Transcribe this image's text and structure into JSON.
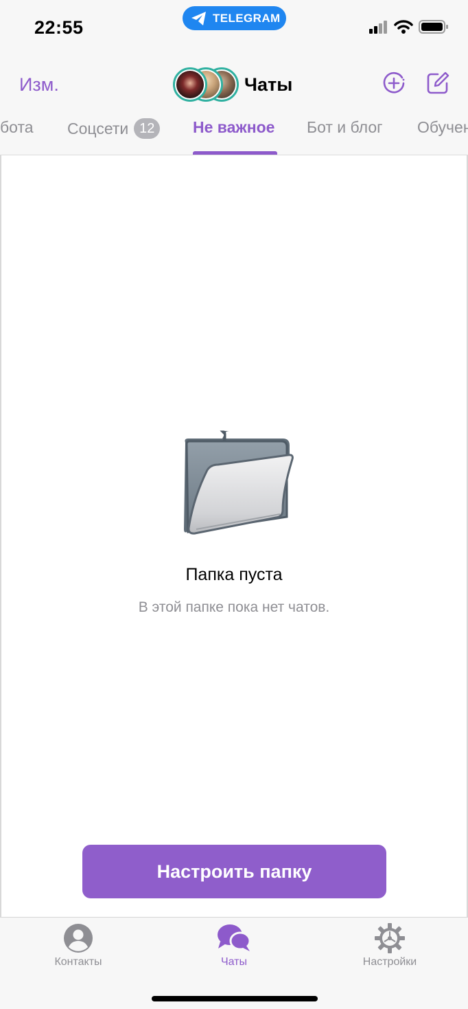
{
  "status_bar": {
    "time": "22:55",
    "pill_label": "TELEGRAM"
  },
  "nav": {
    "edit_label": "Изм.",
    "title": "Чаты",
    "icons": [
      "add-story-icon",
      "compose-icon"
    ]
  },
  "folder_tabs": [
    {
      "label": "бота",
      "active": false
    },
    {
      "label": "Соцсети",
      "badge": "12",
      "active": false
    },
    {
      "label": "Не важное",
      "active": true
    },
    {
      "label": "Бот и блог",
      "active": false
    },
    {
      "label": "Обучен",
      "active": false
    }
  ],
  "empty_state": {
    "title": "Папка пуста",
    "subtitle": "В этой папке пока нет чатов.",
    "icon": "folder-icon"
  },
  "primary_button": {
    "label": "Настроить папку"
  },
  "tab_bar": {
    "items": [
      {
        "label": "Контакты",
        "icon": "contacts-icon",
        "active": false
      },
      {
        "label": "Чаты",
        "icon": "chats-icon",
        "active": true
      },
      {
        "label": "Настройки",
        "icon": "settings-icon",
        "active": false
      }
    ]
  },
  "colors": {
    "accent": "#8d5acb",
    "button": "#8f5ecb",
    "pill": "#1f86f0",
    "muted": "#8e8e93"
  }
}
